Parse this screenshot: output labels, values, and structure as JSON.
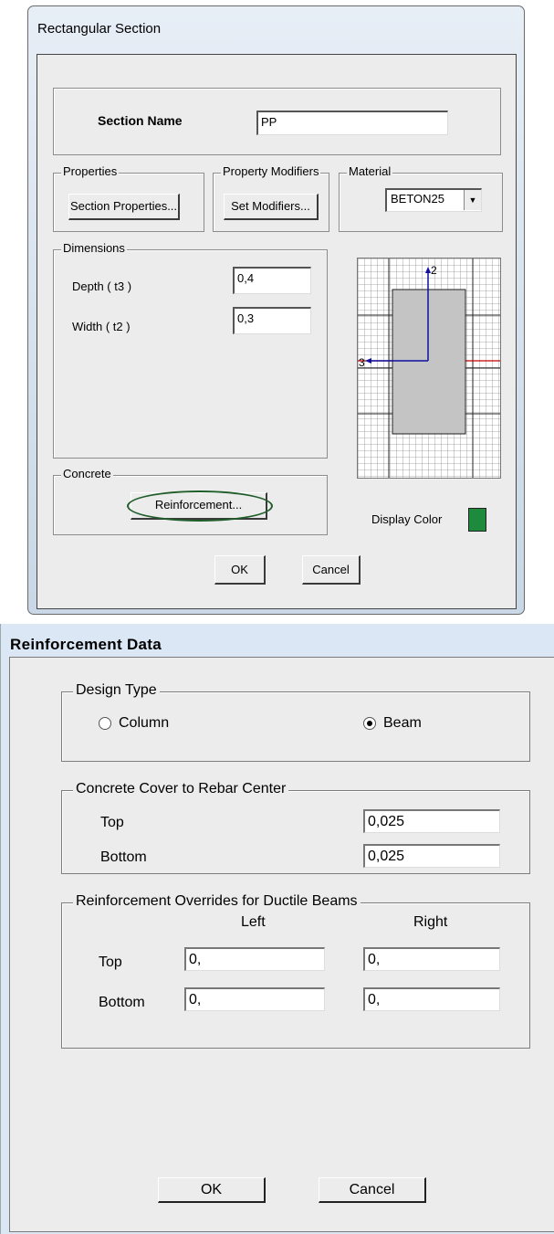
{
  "rect_dialog": {
    "title": "Rectangular Section",
    "section_name_label": "Section Name",
    "section_name_value": "PP",
    "properties_group": "Properties",
    "section_properties_button": "Section Properties...",
    "property_modifiers_group": "Property Modifiers",
    "set_modifiers_button": "Set Modifiers...",
    "material_group": "Material",
    "material_value": "BETON25",
    "dimensions_group": "Dimensions",
    "depth_label": "Depth  ( t3 )",
    "depth_value": "0,4",
    "width_label": "Width  ( t2 )",
    "width_value": "0,3",
    "axis2_label": "2",
    "axis3_label": "3",
    "concrete_group": "Concrete",
    "reinforcement_button": "Reinforcement...",
    "display_color_label": "Display Color",
    "display_color": "#1e8a3c",
    "ok_button": "OK",
    "cancel_button": "Cancel"
  },
  "reinf_dialog": {
    "title": "Reinforcement Data",
    "design_type_group": "Design Type",
    "column_option": "Column",
    "beam_option": "Beam",
    "selected_design_type": "Beam",
    "cover_group": "Concrete Cover to Rebar Center",
    "cover_top_label": "Top",
    "cover_top_value": "0,025",
    "cover_bottom_label": "Bottom",
    "cover_bottom_value": "0,025",
    "overrides_group": "Reinforcement Overrides for Ductile Beams",
    "left_header": "Left",
    "right_header": "Right",
    "ov_top_label": "Top",
    "ov_bottom_label": "Bottom",
    "ov_top_left": "0,",
    "ov_top_right": "0,",
    "ov_bottom_left": "0,",
    "ov_bottom_right": "0,",
    "ok_button": "OK",
    "cancel_button": "Cancel"
  }
}
